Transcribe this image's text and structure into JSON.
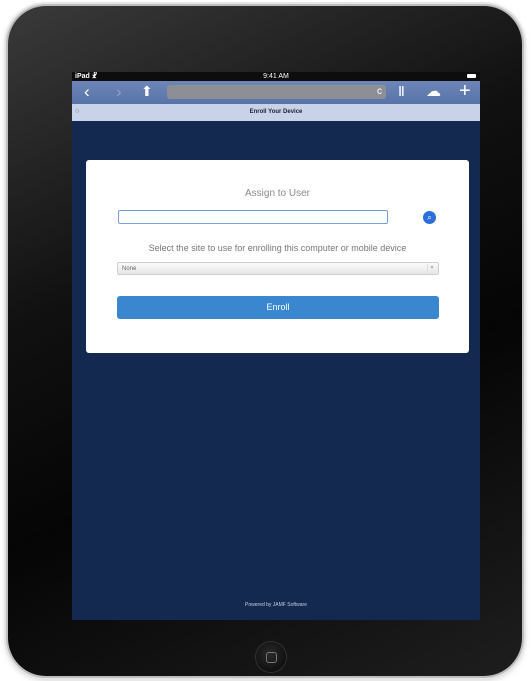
{
  "status_bar": {
    "carrier": "iPad ☧",
    "time": "9:41 AM"
  },
  "toolbar": {
    "back_icon": "‹",
    "forward_icon": "›",
    "share_icon": "⬆",
    "reload_icon": "c",
    "reader_icon": "Ⅱ",
    "cloud_icon": "☁",
    "add_icon": "+"
  },
  "page": {
    "title": "Enroll Your Device",
    "footer": "Powered by JAMF Software"
  },
  "form": {
    "heading": "Assign to User",
    "user_value": "",
    "search_icon": "⌕",
    "site_label": "Select the site to use for enrolling this computer or mobile device",
    "site_selected": "None",
    "enroll_label": "Enroll"
  },
  "colors": {
    "background": "#14294f",
    "toolbar": "#5f79ad",
    "enroll_button": "#3a86cf"
  }
}
